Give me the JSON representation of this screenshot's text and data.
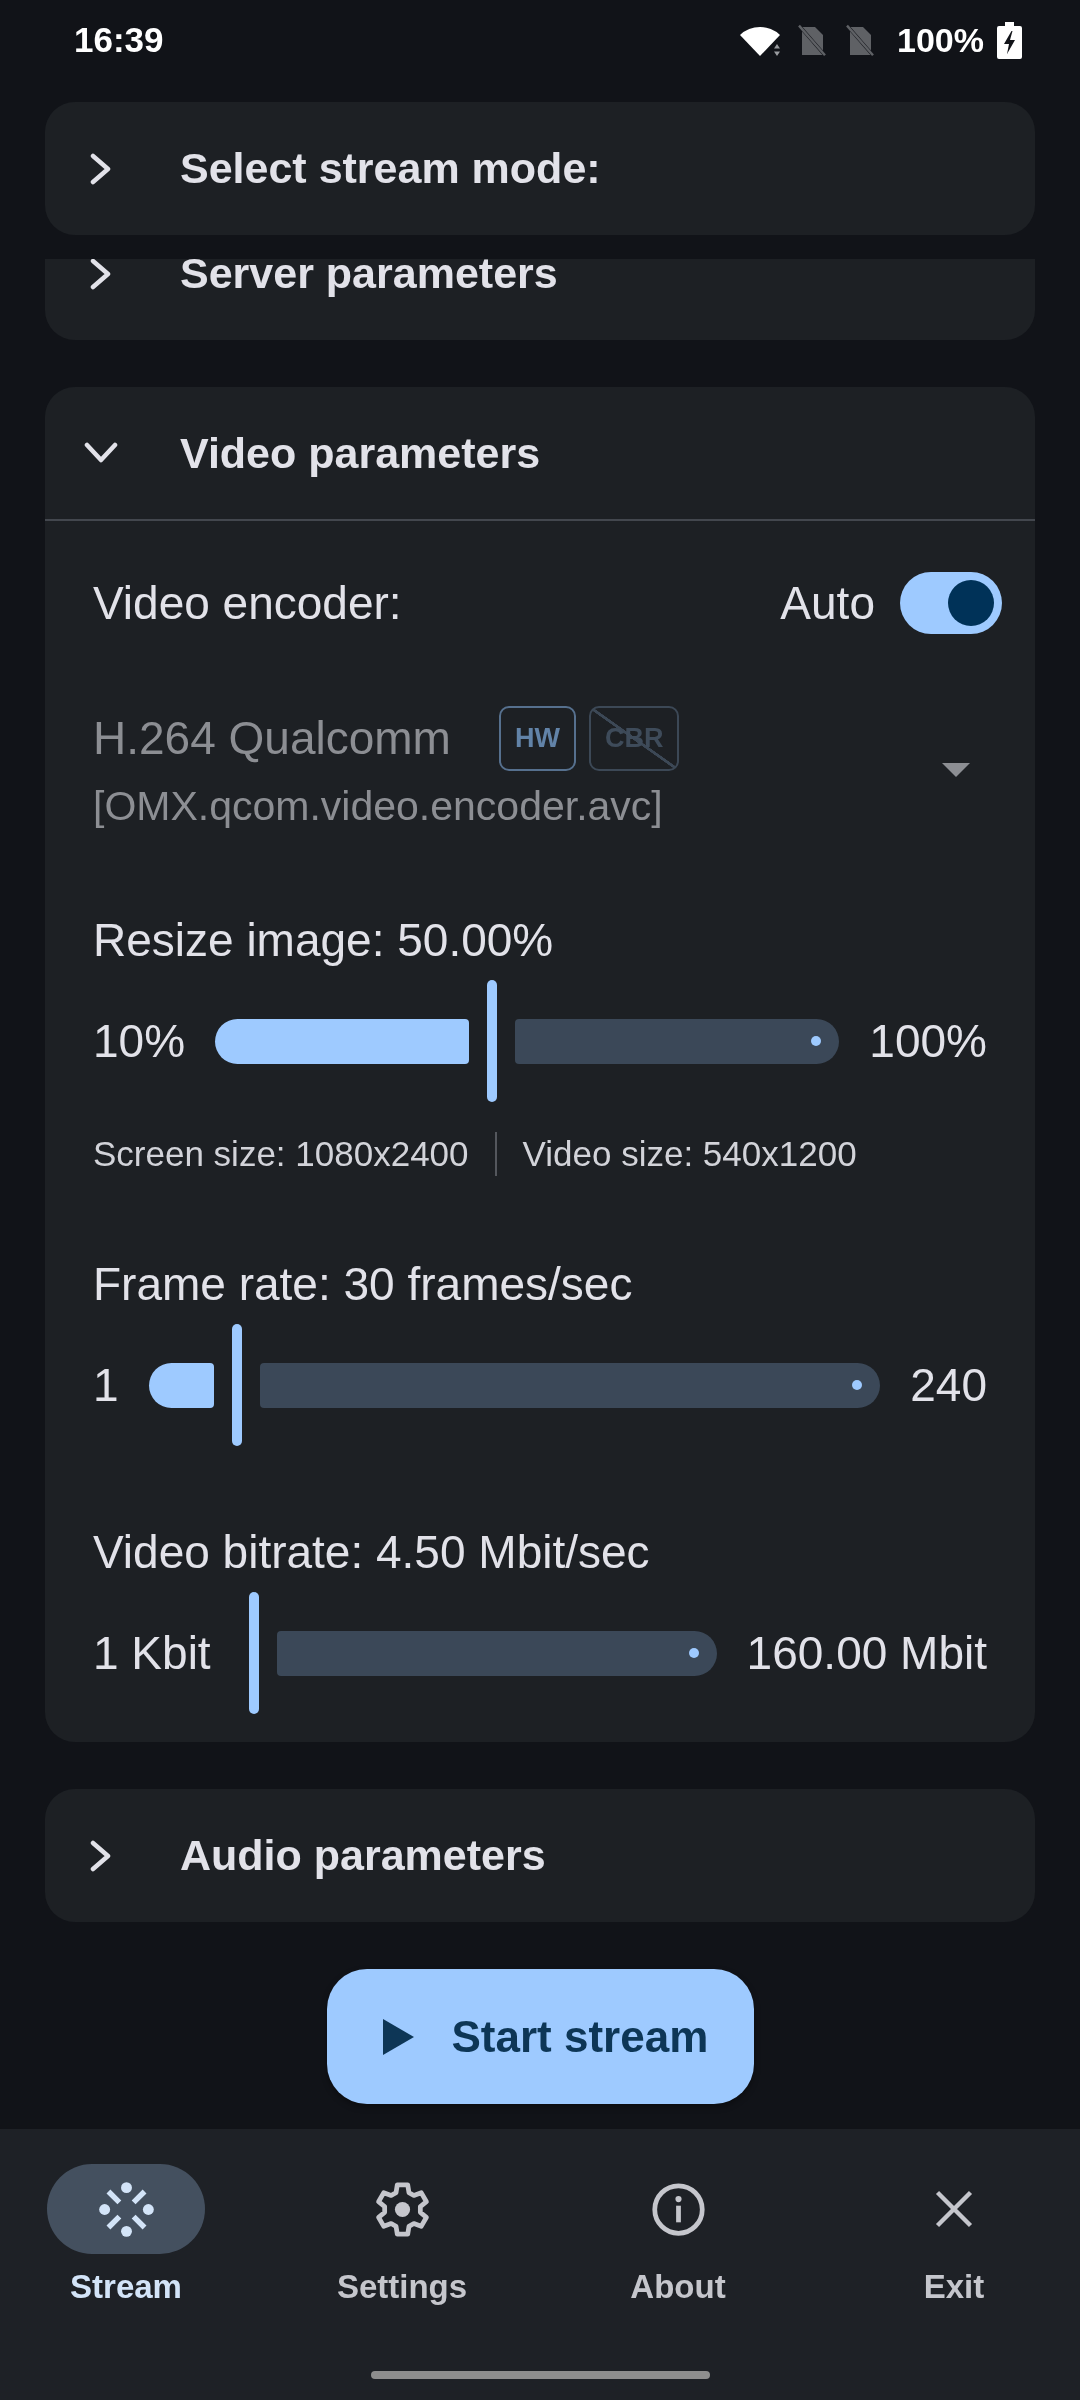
{
  "status_bar": {
    "time": "16:39",
    "battery": "100%"
  },
  "pinned_section": {
    "title": "Select stream mode:",
    "expanded": false
  },
  "sections": [
    {
      "title": "Server parameters",
      "expanded": false
    },
    {
      "title": "Video parameters",
      "expanded": true,
      "encoder": {
        "label": "Video encoder:",
        "auto_label": "Auto",
        "auto": true,
        "name": "H.264 Qualcomm",
        "badges": [
          {
            "label": "HW",
            "supported": true
          },
          {
            "label": "CBR",
            "supported": false
          }
        ],
        "codec": "[OMX.qcom.video.encoder.avc]",
        "disabled": true
      },
      "sliders": [
        {
          "label": "Resize image: 50.00%",
          "min": "10%",
          "max": "100%",
          "level": 0.444,
          "notes": [
            "Screen size: 1080x2400",
            "Video size: 540x1200"
          ]
        },
        {
          "label": "Frame rate: 30 frames/sec",
          "min": "1",
          "max": "240",
          "level": 0.121
        },
        {
          "label": "Video bitrate: 4.50 Mbit/sec",
          "min": "1 Kbit",
          "max": "160.00 Mbit",
          "level": 0.028
        }
      ]
    },
    {
      "title": "Audio parameters",
      "expanded": false
    }
  ],
  "start_button": {
    "label": "Start stream"
  },
  "nav": [
    {
      "label": "Stream",
      "selected": true
    },
    {
      "label": "Settings",
      "selected": false
    },
    {
      "label": "About",
      "selected": false
    },
    {
      "label": "Exit",
      "selected": false
    }
  ]
}
